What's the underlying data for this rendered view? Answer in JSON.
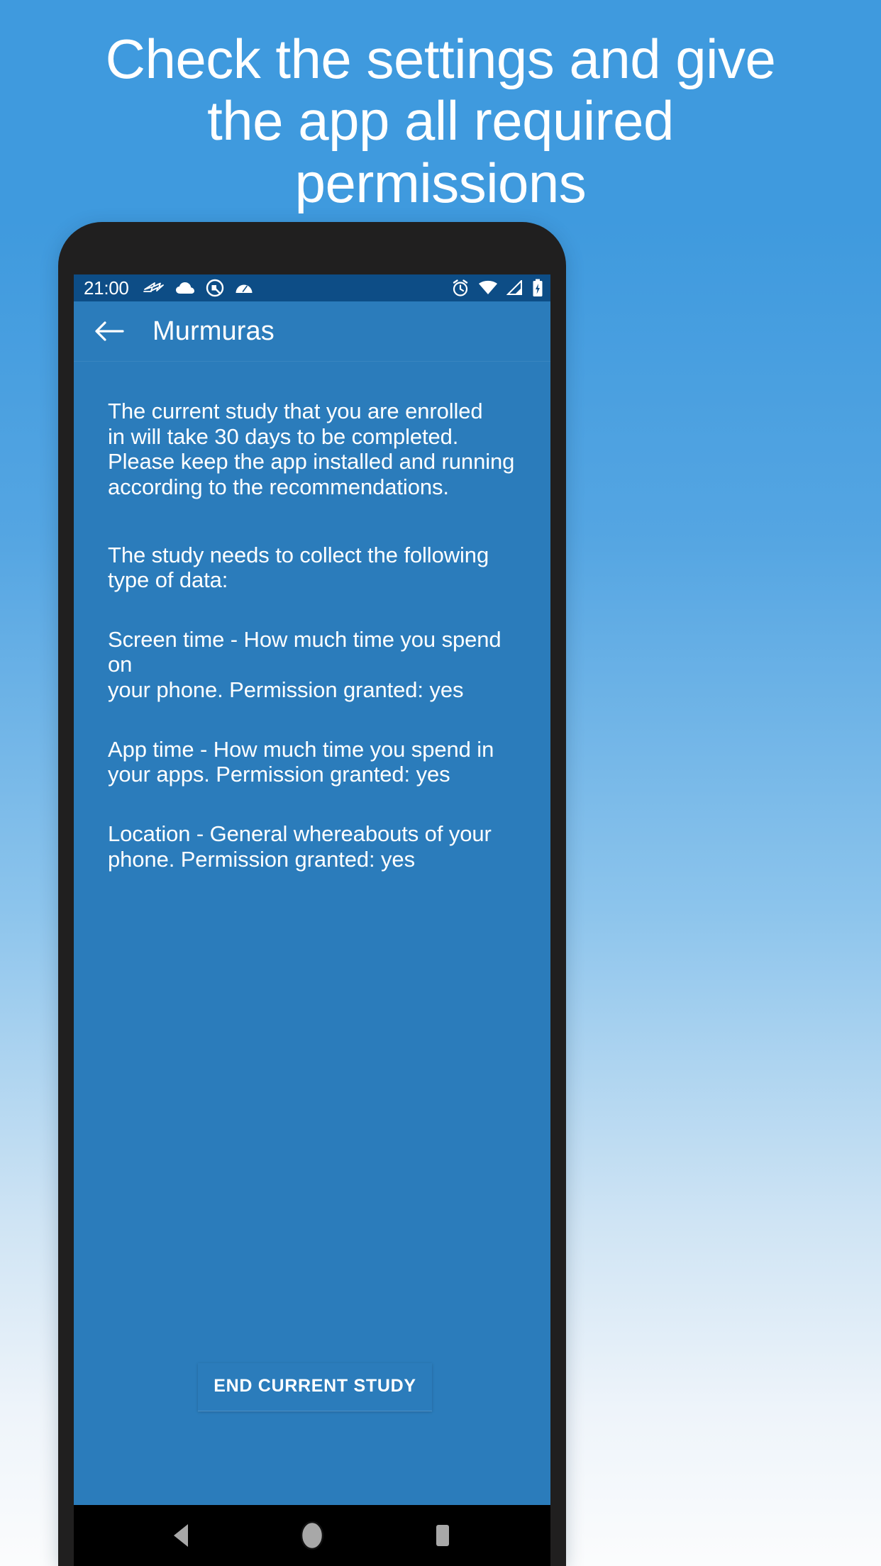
{
  "promo": {
    "lines": [
      "Check the settings and give",
      "the app all required",
      "permissions"
    ]
  },
  "colors": {
    "promo_bg_top": "#3f9ade",
    "promo_bg_bottom": "#fbfcfd",
    "phone_body": "#201f1f",
    "status_bar": "#0d4d86",
    "app_bar": "#2b7cbb",
    "content_bg": "#2b7cbb",
    "nav_bar": "#000000",
    "text": "#ffffff"
  },
  "statusbar": {
    "time": "21:00",
    "left_icons": [
      "flight-mode-icon",
      "cloud-icon",
      "circle-q-icon",
      "speedometer-icon"
    ],
    "right_icons": [
      "alarm-clock-icon",
      "wifi-icon",
      "cellular-signal-icon",
      "battery-charging-icon"
    ]
  },
  "appbar": {
    "back_icon": "arrow-left-icon",
    "title": "Murmuras"
  },
  "content": {
    "paragraphs": [
      "The current study that you are enrolled\nin will take 30 days to be completed.\nPlease keep the app installed and running\naccording to the recommendations.",
      "The study needs to collect the following\ntype of data:",
      "Screen time - How much time you spend on\nyour phone. Permission granted: yes",
      "App time - How much time you spend in\nyour apps. Permission granted: yes",
      "Location - General whereabouts of your\nphone. Permission granted: yes"
    ]
  },
  "actions": {
    "end_study_label": "END CURRENT STUDY"
  },
  "navbar": {
    "buttons": [
      "back-triangle-icon",
      "home-circle-icon",
      "recents-square-icon"
    ]
  }
}
